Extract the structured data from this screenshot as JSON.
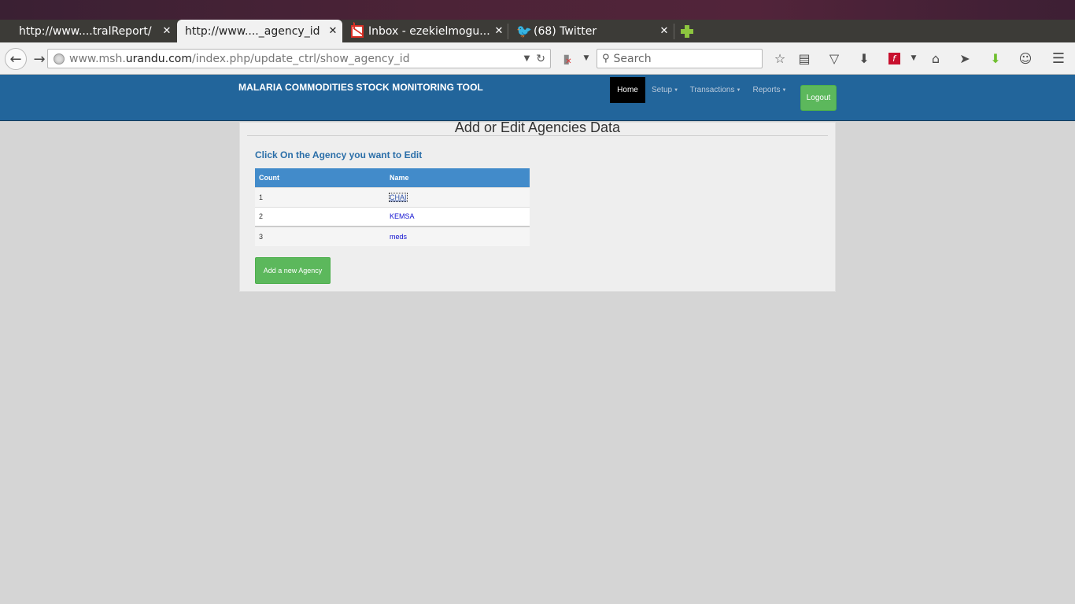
{
  "browser": {
    "tabs": [
      {
        "title": "http://www....tralReport/",
        "active": false
      },
      {
        "title": "http://www...._agency_id",
        "active": true
      },
      {
        "title": "Inbox - ezekielmogu...",
        "active": false,
        "icon": "gmail-icon"
      },
      {
        "title": "(68) Twitter",
        "active": false,
        "icon": "twitter-icon"
      }
    ],
    "close_glyph": "✕",
    "url_prefix": "www.msh.",
    "url_domain": "urandu.com",
    "url_path": "/index.php/update_ctrl/show_agency_id",
    "search_placeholder": "Search"
  },
  "header": {
    "brand": "MALARIA COMMODITIES STOCK MONITORING TOOL",
    "menu": [
      {
        "label": "Home",
        "active": true
      },
      {
        "label": "Setup",
        "dropdown": true
      },
      {
        "label": "Transactions",
        "dropdown": true
      },
      {
        "label": "Reports",
        "dropdown": true
      }
    ],
    "logout_label": "Logout"
  },
  "main": {
    "title": "Add or Edit Agencies Data",
    "instruction": "Click On the Agency you want to Edit",
    "table": {
      "columns": [
        "Count",
        "Name"
      ],
      "rows": [
        {
          "count": "1",
          "name": "CHAI"
        },
        {
          "count": "2",
          "name": "KEMSA"
        },
        {
          "count": "3",
          "name": "meds"
        }
      ]
    },
    "add_button_label": "Add a new Agency"
  },
  "colors": {
    "header_bg": "#22659b",
    "table_header_bg": "#428bca",
    "success_green": "#5cb85c"
  }
}
